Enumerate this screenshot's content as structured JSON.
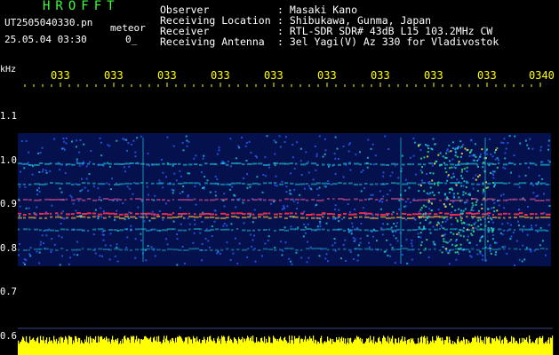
{
  "header": {
    "app_title": "HROFFT",
    "file_name": "UT2505040330.pn",
    "meteor_label": "meteor",
    "timestamp": "25.05.04 03:30",
    "count": "0_"
  },
  "info": [
    {
      "key": "Observer",
      "value": ": Masaki Kano"
    },
    {
      "key": "Receiving Location",
      "value": ": Shibukawa, Gunma, Japan"
    },
    {
      "key": "Receiver",
      "value": ": RTL-SDR SDR# 43dB L15 103.2MHz CW"
    },
    {
      "key": "Receiving Antenna",
      "value": ": 3el Yagi(V) Az 330 for Vladivostok"
    }
  ],
  "spectrogram": {
    "unit_label": "kHz",
    "time_ticks": [
      "033",
      "033",
      "033",
      "033",
      "033",
      "033",
      "033",
      "033",
      "033",
      "0340"
    ],
    "freq_ticks": [
      "1.1",
      "1.0",
      "0.9",
      "0.8",
      "0.7",
      "0.6"
    ],
    "colors": {
      "background": "#000000",
      "noise": "#0a1f8c",
      "signal": "#1ec8e0",
      "strong": "#ff3050",
      "tick": "#ffff00",
      "level_bar": "#ffff00"
    }
  }
}
